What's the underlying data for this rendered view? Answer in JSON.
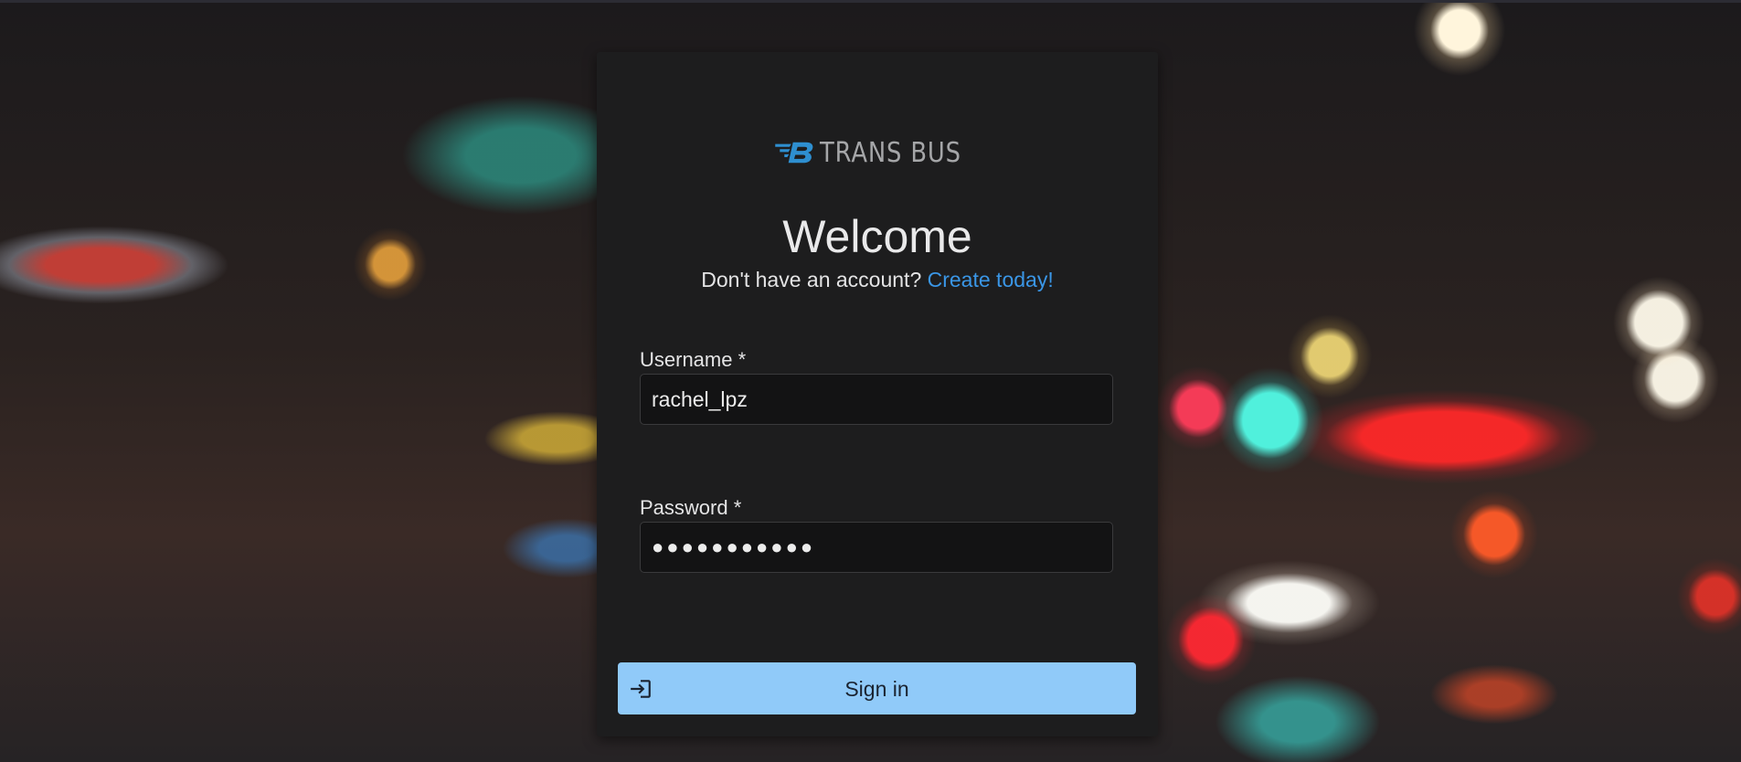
{
  "brand": {
    "name": "TRANS BUS",
    "logo_letter": "B",
    "logo_color": "#2e8fd0",
    "text_color": "#a5a6a8"
  },
  "header": {
    "title": "Welcome",
    "signup_prompt": "Don't have an account?",
    "signup_link": "Create today!"
  },
  "form": {
    "username": {
      "label": "Username  *",
      "value": "rachel_lpz"
    },
    "password": {
      "label": "Password  *",
      "value": "●●●●●●●●●●●"
    },
    "submit": {
      "label": "Sign in",
      "icon": "login-icon"
    }
  },
  "colors": {
    "card_background": "#1d1d1e",
    "accent": "#90caf9",
    "link": "#3a96e6"
  }
}
